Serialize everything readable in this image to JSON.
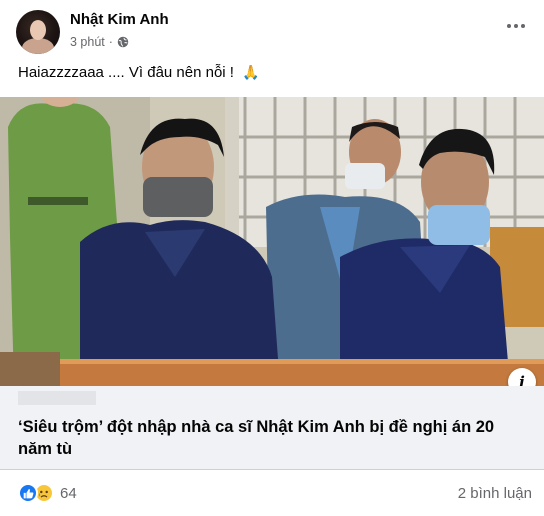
{
  "post": {
    "author": "Nhật Kim Anh",
    "time": "3 phút",
    "separator": "·",
    "caption": "Haiazzzzaaa .... Vì đâu nên nỗi !",
    "caption_emoji": "🙏"
  },
  "link": {
    "domain": "",
    "title": "‘Siêu trộm’ đột nhập nhà ca sĩ Nhật Kim Anh bị đề nghị án 20 năm tù"
  },
  "engagement": {
    "reaction_count": "64",
    "comments": "2 bình luận"
  },
  "info_label": "i",
  "icons": {
    "privacy": "globe-icon",
    "more": "more-options-icon",
    "like": "like-reaction-icon",
    "sad": "sad-reaction-icon",
    "info": "info-icon"
  },
  "colors": {
    "accent": "#1877f2",
    "sad": "#f7c63a",
    "secondary_text": "#65676b",
    "link_bg": "#f0f2f5"
  }
}
